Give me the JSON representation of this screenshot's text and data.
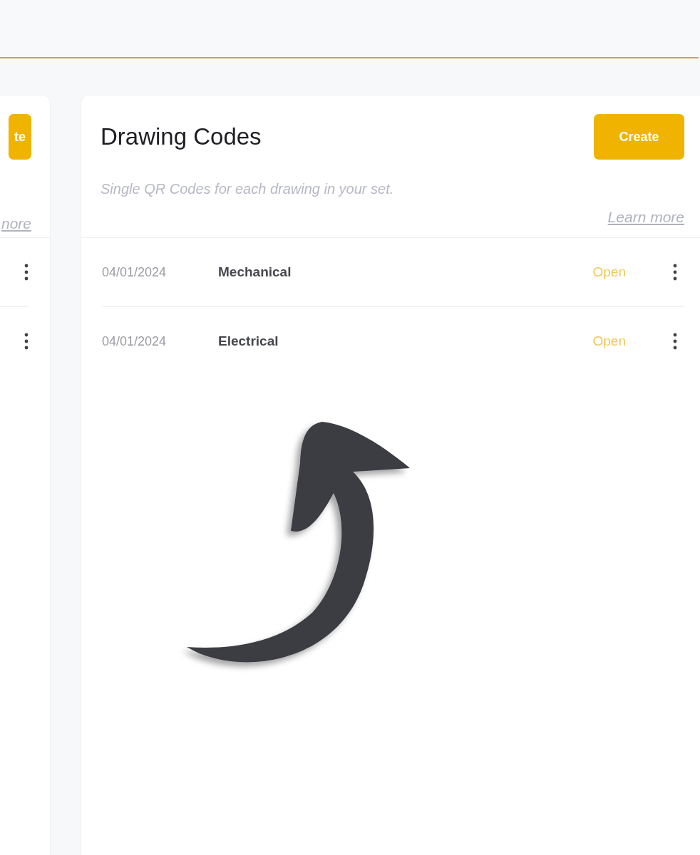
{
  "panels": [
    {
      "kind": "partial",
      "create_button": "te",
      "learn_more": "nore",
      "rows": [
        {
          "kind": "kebab"
        },
        {
          "kind": "kebab"
        }
      ]
    },
    {
      "kind": "full",
      "title": "Drawing Codes",
      "create_button": "Create",
      "subtitle": "Single QR Codes for each drawing in your set.",
      "learn_more": "Learn more",
      "rows": [
        {
          "date": "04/01/2024",
          "name": "Mechanical",
          "action": "Open"
        },
        {
          "date": "04/01/2024",
          "name": "Electrical",
          "action": "Open"
        }
      ]
    }
  ]
}
